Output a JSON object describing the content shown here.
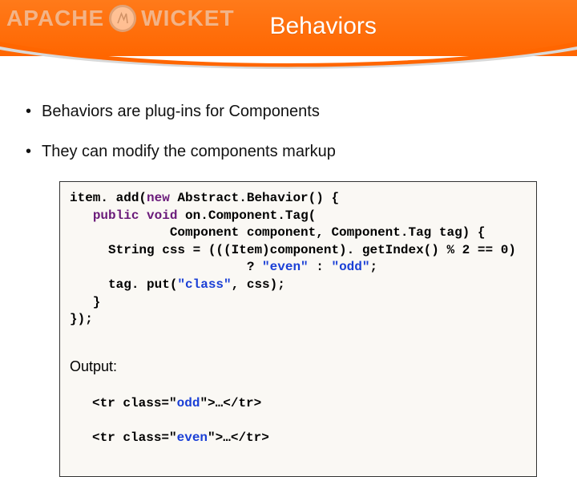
{
  "header": {
    "title": "Behaviors",
    "logo_text_1": "APACHE",
    "logo_text_2": "WICKET"
  },
  "bullets": [
    "Behaviors are plug-ins for Components",
    "They can modify the components markup"
  ],
  "code": {
    "l1a": "item. add(",
    "l1_kw": "new",
    "l1b": " Abstract.Behavior() {",
    "l2_indent": "   ",
    "l2_kw": "public void",
    "l2b": " on.Component.Tag(",
    "l3": "             Component component, Component.Tag tag) {",
    "l4a": "     String css = (((Item)component). getIndex() % 2 == 0)",
    "l5a": "                       ? ",
    "l5_s1": "\"even\"",
    "l5b": " : ",
    "l5_s2": "\"odd\"",
    "l5c": ";",
    "l6a": "     tag. put(",
    "l6_s": "\"class\"",
    "l6b": ", css);",
    "l7": "   }",
    "l8": "});"
  },
  "output": {
    "label": "Output:",
    "r1a": "<tr class=\"",
    "r1_cls": "odd",
    "r1b": "\">…</tr>",
    "r2a": "<tr class=\"",
    "r2_cls": "even",
    "r2b": "\">…</tr>"
  }
}
